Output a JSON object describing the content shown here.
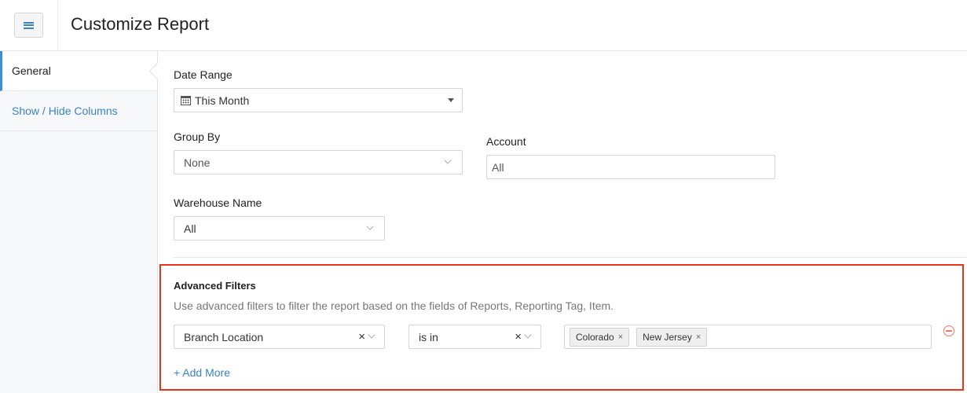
{
  "header": {
    "title": "Customize Report",
    "menu_icon": "hamburger-menu-icon"
  },
  "sidebar": {
    "items": [
      {
        "label": "General",
        "active": true
      },
      {
        "label": "Show / Hide Columns",
        "active": false
      }
    ]
  },
  "form": {
    "date_range": {
      "label": "Date Range",
      "value": "This Month",
      "icon": "calendar-icon"
    },
    "group_by": {
      "label": "Group By",
      "value": "None"
    },
    "account": {
      "label": "Account",
      "value": "All"
    },
    "warehouse": {
      "label": "Warehouse Name",
      "value": "All"
    }
  },
  "advanced_filters": {
    "title": "Advanced Filters",
    "description": "Use advanced filters to filter the report based on the fields of Reports, Reporting Tag, Item.",
    "rows": [
      {
        "field": "Branch Location",
        "operator": "is in",
        "values": [
          "Colorado",
          "New Jersey"
        ]
      }
    ],
    "add_more_label": "+ Add More",
    "clear_glyph": "×",
    "tag_remove_glyph": "×",
    "highlight_color": "#f0311a"
  },
  "colors": {
    "accent": "#3b82c4",
    "remove": "#f07a6a"
  }
}
